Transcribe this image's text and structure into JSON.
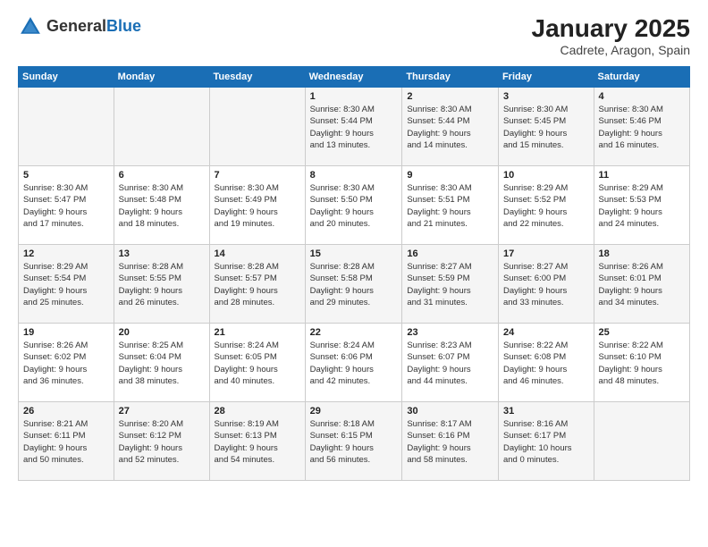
{
  "logo": {
    "general": "General",
    "blue": "Blue"
  },
  "title": "January 2025",
  "subtitle": "Cadrete, Aragon, Spain",
  "weekdays": [
    "Sunday",
    "Monday",
    "Tuesday",
    "Wednesday",
    "Thursday",
    "Friday",
    "Saturday"
  ],
  "weeks": [
    [
      {
        "day": "",
        "info": ""
      },
      {
        "day": "",
        "info": ""
      },
      {
        "day": "",
        "info": ""
      },
      {
        "day": "1",
        "info": "Sunrise: 8:30 AM\nSunset: 5:44 PM\nDaylight: 9 hours\nand 13 minutes."
      },
      {
        "day": "2",
        "info": "Sunrise: 8:30 AM\nSunset: 5:44 PM\nDaylight: 9 hours\nand 14 minutes."
      },
      {
        "day": "3",
        "info": "Sunrise: 8:30 AM\nSunset: 5:45 PM\nDaylight: 9 hours\nand 15 minutes."
      },
      {
        "day": "4",
        "info": "Sunrise: 8:30 AM\nSunset: 5:46 PM\nDaylight: 9 hours\nand 16 minutes."
      }
    ],
    [
      {
        "day": "5",
        "info": "Sunrise: 8:30 AM\nSunset: 5:47 PM\nDaylight: 9 hours\nand 17 minutes."
      },
      {
        "day": "6",
        "info": "Sunrise: 8:30 AM\nSunset: 5:48 PM\nDaylight: 9 hours\nand 18 minutes."
      },
      {
        "day": "7",
        "info": "Sunrise: 8:30 AM\nSunset: 5:49 PM\nDaylight: 9 hours\nand 19 minutes."
      },
      {
        "day": "8",
        "info": "Sunrise: 8:30 AM\nSunset: 5:50 PM\nDaylight: 9 hours\nand 20 minutes."
      },
      {
        "day": "9",
        "info": "Sunrise: 8:30 AM\nSunset: 5:51 PM\nDaylight: 9 hours\nand 21 minutes."
      },
      {
        "day": "10",
        "info": "Sunrise: 8:29 AM\nSunset: 5:52 PM\nDaylight: 9 hours\nand 22 minutes."
      },
      {
        "day": "11",
        "info": "Sunrise: 8:29 AM\nSunset: 5:53 PM\nDaylight: 9 hours\nand 24 minutes."
      }
    ],
    [
      {
        "day": "12",
        "info": "Sunrise: 8:29 AM\nSunset: 5:54 PM\nDaylight: 9 hours\nand 25 minutes."
      },
      {
        "day": "13",
        "info": "Sunrise: 8:28 AM\nSunset: 5:55 PM\nDaylight: 9 hours\nand 26 minutes."
      },
      {
        "day": "14",
        "info": "Sunrise: 8:28 AM\nSunset: 5:57 PM\nDaylight: 9 hours\nand 28 minutes."
      },
      {
        "day": "15",
        "info": "Sunrise: 8:28 AM\nSunset: 5:58 PM\nDaylight: 9 hours\nand 29 minutes."
      },
      {
        "day": "16",
        "info": "Sunrise: 8:27 AM\nSunset: 5:59 PM\nDaylight: 9 hours\nand 31 minutes."
      },
      {
        "day": "17",
        "info": "Sunrise: 8:27 AM\nSunset: 6:00 PM\nDaylight: 9 hours\nand 33 minutes."
      },
      {
        "day": "18",
        "info": "Sunrise: 8:26 AM\nSunset: 6:01 PM\nDaylight: 9 hours\nand 34 minutes."
      }
    ],
    [
      {
        "day": "19",
        "info": "Sunrise: 8:26 AM\nSunset: 6:02 PM\nDaylight: 9 hours\nand 36 minutes."
      },
      {
        "day": "20",
        "info": "Sunrise: 8:25 AM\nSunset: 6:04 PM\nDaylight: 9 hours\nand 38 minutes."
      },
      {
        "day": "21",
        "info": "Sunrise: 8:24 AM\nSunset: 6:05 PM\nDaylight: 9 hours\nand 40 minutes."
      },
      {
        "day": "22",
        "info": "Sunrise: 8:24 AM\nSunset: 6:06 PM\nDaylight: 9 hours\nand 42 minutes."
      },
      {
        "day": "23",
        "info": "Sunrise: 8:23 AM\nSunset: 6:07 PM\nDaylight: 9 hours\nand 44 minutes."
      },
      {
        "day": "24",
        "info": "Sunrise: 8:22 AM\nSunset: 6:08 PM\nDaylight: 9 hours\nand 46 minutes."
      },
      {
        "day": "25",
        "info": "Sunrise: 8:22 AM\nSunset: 6:10 PM\nDaylight: 9 hours\nand 48 minutes."
      }
    ],
    [
      {
        "day": "26",
        "info": "Sunrise: 8:21 AM\nSunset: 6:11 PM\nDaylight: 9 hours\nand 50 minutes."
      },
      {
        "day": "27",
        "info": "Sunrise: 8:20 AM\nSunset: 6:12 PM\nDaylight: 9 hours\nand 52 minutes."
      },
      {
        "day": "28",
        "info": "Sunrise: 8:19 AM\nSunset: 6:13 PM\nDaylight: 9 hours\nand 54 minutes."
      },
      {
        "day": "29",
        "info": "Sunrise: 8:18 AM\nSunset: 6:15 PM\nDaylight: 9 hours\nand 56 minutes."
      },
      {
        "day": "30",
        "info": "Sunrise: 8:17 AM\nSunset: 6:16 PM\nDaylight: 9 hours\nand 58 minutes."
      },
      {
        "day": "31",
        "info": "Sunrise: 8:16 AM\nSunset: 6:17 PM\nDaylight: 10 hours\nand 0 minutes."
      },
      {
        "day": "",
        "info": ""
      }
    ]
  ]
}
